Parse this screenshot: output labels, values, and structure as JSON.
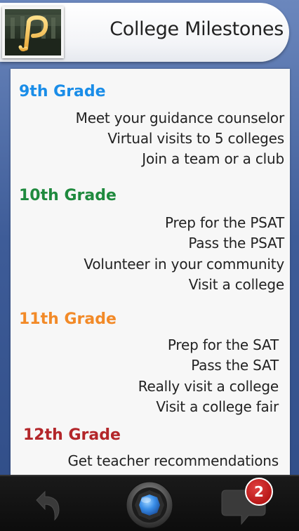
{
  "header": {
    "title": "College Milestones",
    "logo_icon": "p-monogram-logo"
  },
  "sections": [
    {
      "heading": "9th Grade",
      "color": "#1a8de8",
      "items": [
        "Meet your guidance counselor",
        "Virtual visits to 5 colleges",
        "Join a team or a club"
      ]
    },
    {
      "heading": "10th Grade",
      "color": "#1f8a3e",
      "items": [
        "Prep for the PSAT",
        "Pass the PSAT",
        "Volunteer in your community",
        "Visit a college"
      ]
    },
    {
      "heading": "11th Grade",
      "color": "#f28a28",
      "items": [
        "Prep for the SAT",
        "Pass the SAT",
        "Really visit a college",
        "Visit a college fair"
      ]
    },
    {
      "heading": "12th Grade",
      "color": "#b3262a",
      "items": [
        "Get teacher recommendations"
      ]
    }
  ],
  "bottombar": {
    "back_icon": "back-arrow-icon",
    "camera_icon": "camera-shutter-icon",
    "chat_icon": "chat-bubble-icon",
    "badge_count": "2",
    "badge_color": "#c62020"
  }
}
